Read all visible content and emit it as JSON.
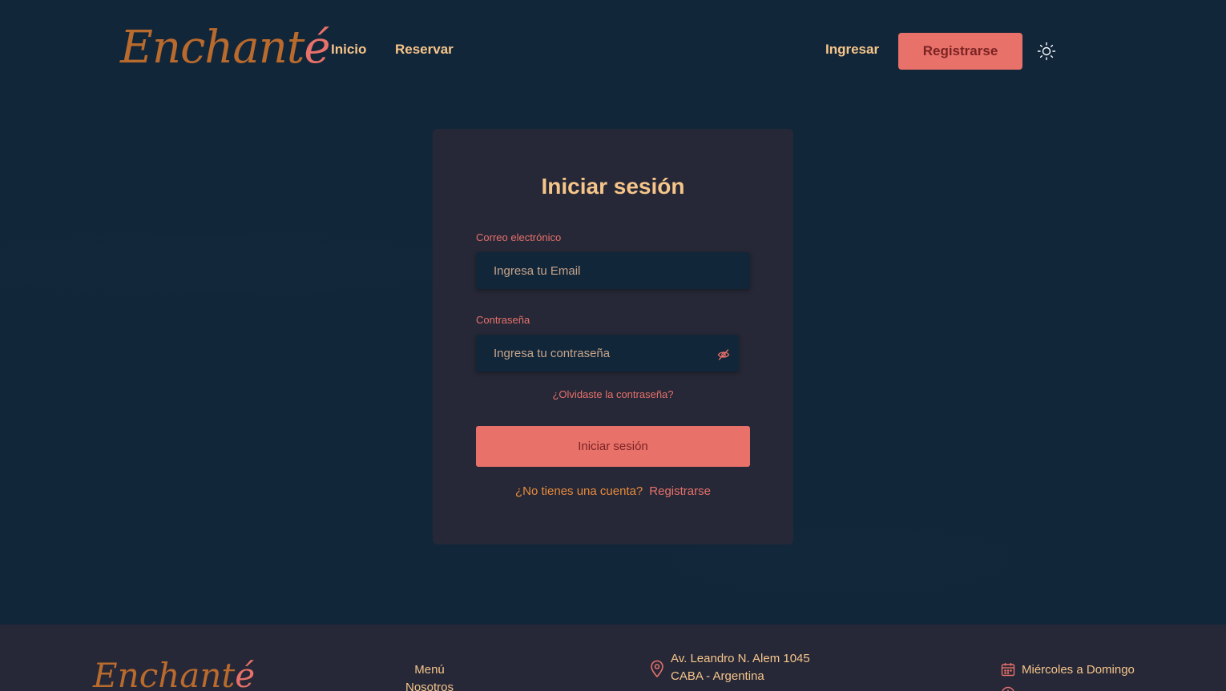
{
  "brand": {
    "logo_main": "Enchant",
    "logo_accent": "é"
  },
  "nav": {
    "inicio": "Inicio",
    "reservar": "Reservar",
    "ingresar": "Ingresar",
    "registrarse": "Registrarse",
    "theme_icon": "sun-icon"
  },
  "login": {
    "title": "Iniciar sesión",
    "email_label": "Correo electrónico",
    "email_placeholder": "Ingresa tu Email",
    "email_value": "",
    "password_label": "Contraseña",
    "password_placeholder": "Ingresa tu contraseña",
    "password_value": "",
    "password_toggle_icon": "eye-off-icon",
    "forgot": "¿Olvidaste la contraseña?",
    "submit": "Iniciar sesión",
    "no_account": "¿No tienes una cuenta?",
    "register_link": "Registrarse"
  },
  "footer": {
    "logo_main": "Enchant",
    "logo_accent": "é",
    "links": [
      "Menú",
      "Nosotros"
    ],
    "address_line1": "Av. Leandro N. Alem 1045",
    "address_line2": "CABA - Argentina",
    "days": "Miércoles a Domingo",
    "hours": ""
  },
  "colors": {
    "background": "#12263a",
    "card": "#262837",
    "accent": "#e8716a",
    "gold": "#f6c58a",
    "logo": "#b96a2d"
  }
}
